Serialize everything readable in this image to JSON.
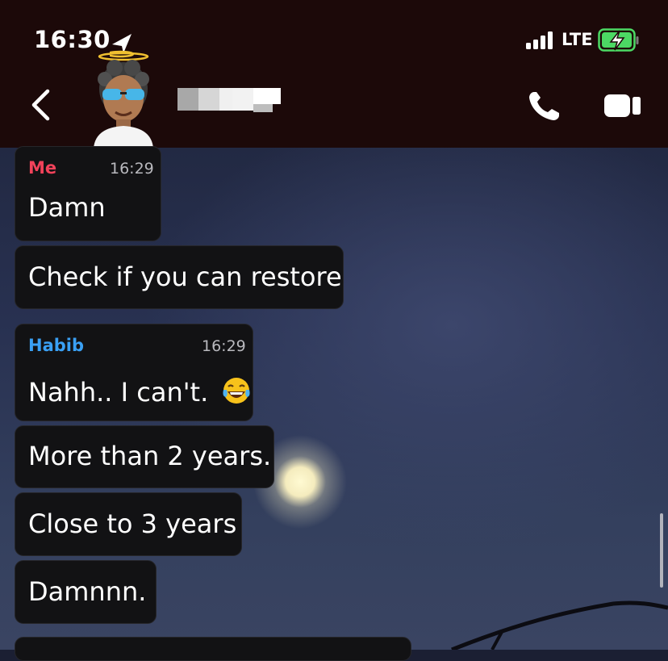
{
  "status_bar": {
    "time": "16:30",
    "network": "LTE"
  },
  "header": {
    "contact_name": "",
    "icons": [
      "chevron-left-icon",
      "bitmoji-avatar",
      "phone-icon",
      "video-camera-icon"
    ]
  },
  "messages": [
    {
      "sender": "Me",
      "time": "16:29",
      "lines": [
        "Damn",
        "Check if you can restore"
      ]
    },
    {
      "sender": "Habib",
      "time": "16:29",
      "lines": [
        "Nahh.. I can't.",
        "More than 2 years.",
        "Close to 3 years",
        "Damnnn."
      ]
    }
  ],
  "colors": {
    "header_bg": "#1c0909",
    "bubble_bg": "#121214",
    "me_name": "#f2425a",
    "habib_name": "#3aa0f4"
  }
}
